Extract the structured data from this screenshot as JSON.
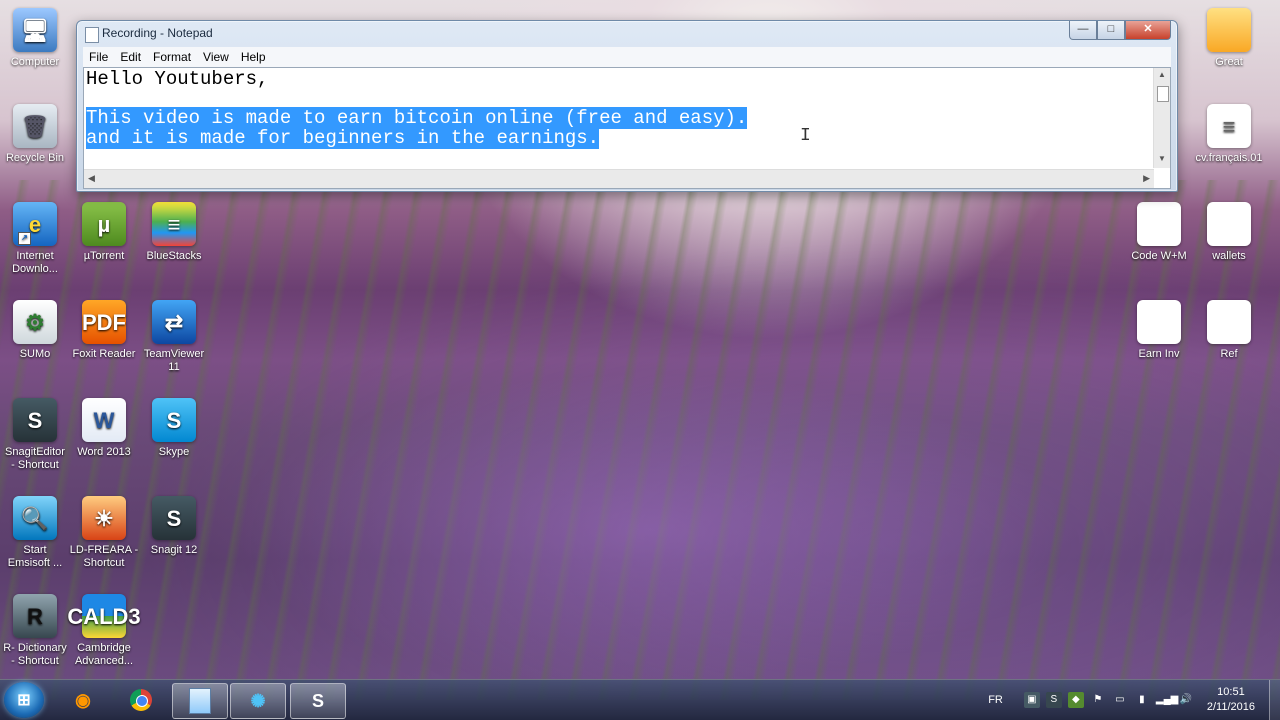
{
  "desktop": {
    "icons": {
      "computer": "Computer",
      "recycle_bin": "Recycle Bin",
      "internet_download": "Internet Downlo...",
      "utorrent": "µTorrent",
      "bluestacks": "BlueStacks",
      "sumo": "SUMo",
      "foxit": "Foxit Reader",
      "teamviewer_1": "TeamViewer",
      "teamviewer_2": "11",
      "snagit_editor_1": "SnagitEditor",
      "snagit_editor_2": "- Shortcut",
      "word": "Word 2013",
      "skype": "Skype",
      "start_emsisoft_1": "Start",
      "start_emsisoft_2": "Emsisoft ...",
      "ld_freara_1": "LD-FREARA -",
      "ld_freara_2": "Shortcut",
      "snagit12": "Snagit 12",
      "r_dictionary_1": "R- Dictionary",
      "r_dictionary_2": "- Shortcut",
      "cambridge_1": "Cambridge",
      "cambridge_2": "Advanced...",
      "cambridge_badge": "CALD3",
      "great": "Great",
      "cv_francais": "cv.français.01",
      "code_wm": "Code W+M",
      "wallets": "wallets",
      "earn_inv": "Earn Inv",
      "ref": "Ref"
    }
  },
  "notepad": {
    "title": "Recording - Notepad",
    "menu": [
      "File",
      "Edit",
      "Format",
      "View",
      "Help"
    ],
    "line1": "Hello Youtubers,",
    "line3": "This video is made to earn bitcoin online (free and easy).",
    "line4": "and it is made for beginners in the earnings.",
    "buttons": {
      "minimize": "—",
      "maximize": "□",
      "close": "✕"
    }
  },
  "taskbar": {
    "language": "FR",
    "time": "10:51",
    "date": "2/11/2016"
  },
  "icons": {
    "start": "windows-logo",
    "firefox": "firefox-icon",
    "chrome": "chrome-icon",
    "notepad": "notepad-icon",
    "film": "film-reel-icon",
    "snagit": "snagit-icon"
  }
}
